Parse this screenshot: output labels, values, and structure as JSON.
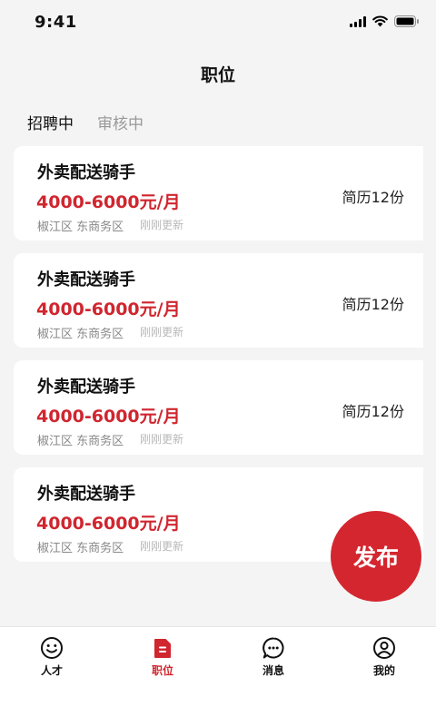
{
  "status": {
    "time": "9:41"
  },
  "header": {
    "title": "职位"
  },
  "tabs": [
    {
      "label": "招聘中",
      "active": true
    },
    {
      "label": "审核中",
      "active": false
    }
  ],
  "jobs": [
    {
      "title": "外卖配送骑手",
      "salary": "4000-6000元/月",
      "location": "椒江区 东商务区",
      "updated": "刚刚更新",
      "resumes": "简历12份"
    },
    {
      "title": "外卖配送骑手",
      "salary": "4000-6000元/月",
      "location": "椒江区 东商务区",
      "updated": "刚刚更新",
      "resumes": "简历12份"
    },
    {
      "title": "外卖配送骑手",
      "salary": "4000-6000元/月",
      "location": "椒江区 东商务区",
      "updated": "刚刚更新",
      "resumes": "简历12份"
    },
    {
      "title": "外卖配送骑手",
      "salary": "4000-6000元/月",
      "location": "椒江区 东商务区",
      "updated": "刚刚更新",
      "resumes": ""
    }
  ],
  "fab": {
    "label": "发布"
  },
  "nav": [
    {
      "label": "人才",
      "icon": "smile-icon"
    },
    {
      "label": "职位",
      "icon": "document-icon",
      "active": true
    },
    {
      "label": "消息",
      "icon": "chat-bubble-icon"
    },
    {
      "label": "我的",
      "icon": "user-circle-icon"
    }
  ],
  "colors": {
    "accent": "#d0262f",
    "background": "#f4f4f4",
    "card": "#ffffff"
  }
}
